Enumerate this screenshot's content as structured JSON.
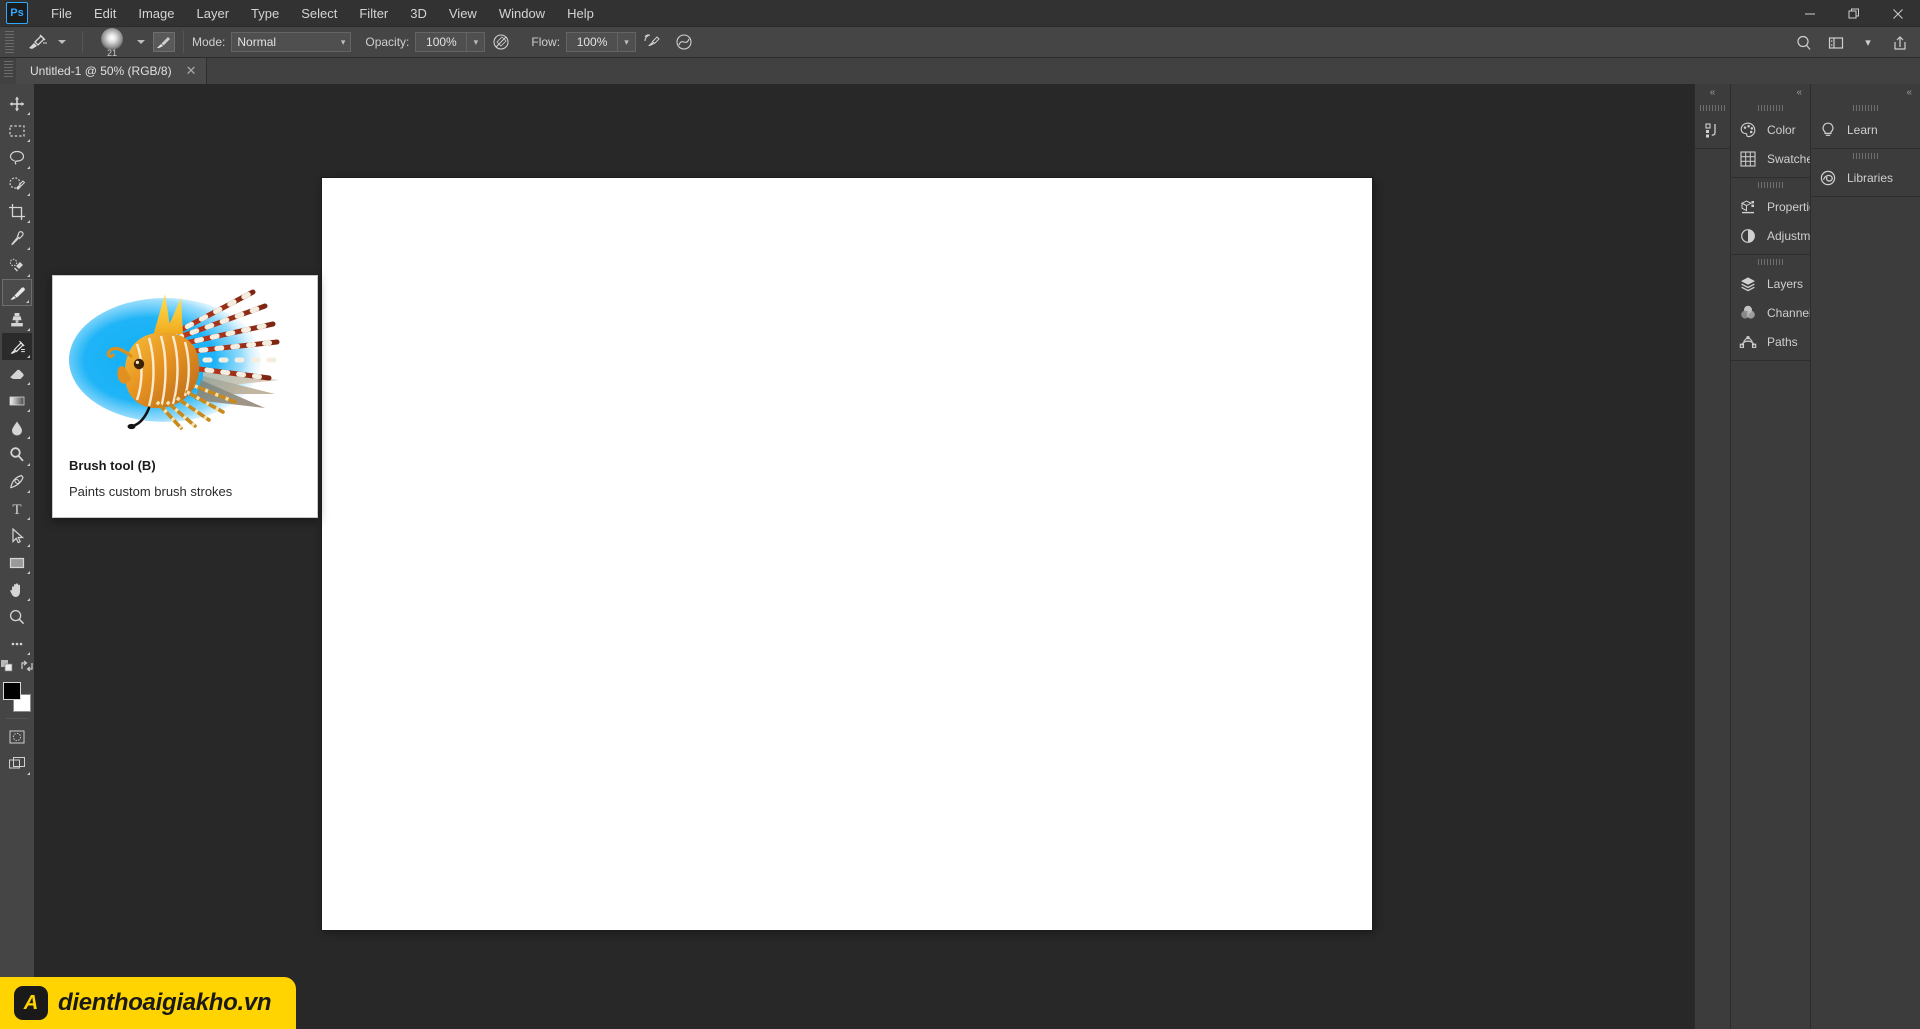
{
  "app": {
    "logo": "Ps",
    "menu": [
      "File",
      "Edit",
      "Image",
      "Layer",
      "Type",
      "Select",
      "Filter",
      "3D",
      "View",
      "Window",
      "Help"
    ],
    "window_controls": [
      {
        "name": "minimize",
        "glyph": "—"
      },
      {
        "name": "restore",
        "glyph": "❐"
      },
      {
        "name": "close",
        "glyph": "✕"
      }
    ]
  },
  "options_bar": {
    "tool_preset_label": "brush-tool-preset",
    "brush_size": "21",
    "mode_label": "Mode:",
    "mode_value": "Normal",
    "opacity_label": "Opacity:",
    "opacity_value": "100%",
    "flow_label": "Flow:",
    "flow_value": "100%",
    "airbrush_name": "airbrush-toggle",
    "smoothing_name": "smoothing-toggle",
    "pressure_opacity_name": "pressure-opacity-toggle",
    "pressure_size_name": "pressure-size-toggle",
    "symmetry_name": "symmetry-toggle",
    "right_icons": [
      {
        "name": "search-icon",
        "glyph": "⚲"
      },
      {
        "name": "workspace-icon",
        "glyph": "▣"
      },
      {
        "name": "workspace-chevron-icon",
        "glyph": "⌄"
      },
      {
        "name": "share-icon",
        "glyph": "⇧"
      }
    ]
  },
  "tabs": [
    {
      "title": "Untitled-1 @ 50% (RGB/8)",
      "close": "✕",
      "active": true
    }
  ],
  "toolbar": {
    "tools": [
      {
        "name": "move-tool",
        "label": "Move tool",
        "state": "normal",
        "flyout": true
      },
      {
        "name": "rectangular-marquee-tool",
        "label": "Rectangular Marquee tool",
        "state": "normal",
        "flyout": true
      },
      {
        "name": "lasso-tool",
        "label": "Lasso tool",
        "state": "normal",
        "flyout": true
      },
      {
        "name": "quick-selection-tool",
        "label": "Object Selection tool",
        "state": "normal",
        "flyout": true
      },
      {
        "name": "crop-tool",
        "label": "Crop tool",
        "state": "normal",
        "flyout": true
      },
      {
        "name": "eyedropper-tool",
        "label": "Eyedropper tool",
        "state": "normal",
        "flyout": true
      },
      {
        "name": "spot-healing-brush-tool",
        "label": "Spot Healing Brush tool",
        "state": "normal",
        "flyout": true
      },
      {
        "name": "brush-tool",
        "label": "Brush tool",
        "state": "hover",
        "flyout": true
      },
      {
        "name": "clone-stamp-tool",
        "label": "Clone Stamp tool",
        "state": "normal",
        "flyout": true
      },
      {
        "name": "history-brush-tool",
        "label": "History Brush tool",
        "state": "active",
        "flyout": true
      },
      {
        "name": "eraser-tool",
        "label": "Eraser tool",
        "state": "normal",
        "flyout": true
      },
      {
        "name": "gradient-tool",
        "label": "Gradient tool",
        "state": "normal",
        "flyout": true
      },
      {
        "name": "blur-tool",
        "label": "Blur tool",
        "state": "normal",
        "flyout": true
      },
      {
        "name": "dodge-tool",
        "label": "Dodge tool",
        "state": "normal",
        "flyout": true
      },
      {
        "name": "pen-tool",
        "label": "Pen tool",
        "state": "normal",
        "flyout": true
      },
      {
        "name": "horizontal-type-tool",
        "label": "Horizontal Type tool",
        "state": "normal",
        "flyout": true
      },
      {
        "name": "path-selection-tool",
        "label": "Path Selection tool",
        "state": "normal",
        "flyout": true
      },
      {
        "name": "rectangle-tool",
        "label": "Rectangle tool",
        "state": "normal",
        "flyout": true
      },
      {
        "name": "hand-tool",
        "label": "Hand tool",
        "state": "normal",
        "flyout": true
      },
      {
        "name": "zoom-tool",
        "label": "Zoom tool",
        "state": "normal",
        "flyout": true
      },
      {
        "name": "edit-toolbar-button",
        "label": "Edit Toolbar",
        "state": "normal",
        "flyout": true
      }
    ],
    "foreground_color": "#000000",
    "background_color": "#ffffff",
    "default_colors_name": "default-colors-icon",
    "swap_colors_name": "swap-colors-icon",
    "quick_mask_name": "quick-mask-button",
    "screen_mode_name": "screen-mode-button"
  },
  "tooltip": {
    "title": "Brush tool (B)",
    "description": "Paints custom brush strokes",
    "image_name": "lionfish-brush-illustration"
  },
  "document": {
    "zoom": "50%",
    "color_mode": "RGB/8",
    "canvas_background": "#ffffff"
  },
  "panels": {
    "collapse_glyph": "«",
    "column_narrow": [
      {
        "name": "history-panel-icon",
        "label": "History"
      }
    ],
    "groups": [
      {
        "items": [
          {
            "name": "color-panel",
            "label": "Color",
            "icon": "color-palette-icon"
          },
          {
            "name": "swatches-panel",
            "label": "Swatches",
            "icon": "swatches-grid-icon"
          }
        ]
      },
      {
        "items": [
          {
            "name": "properties-panel",
            "label": "Properties",
            "icon": "properties-icon"
          },
          {
            "name": "adjustments-panel",
            "label": "Adjustments",
            "icon": "adjustments-half-circle-icon"
          }
        ]
      },
      {
        "items": [
          {
            "name": "layers-panel",
            "label": "Layers",
            "icon": "layers-stack-icon"
          },
          {
            "name": "channels-panel",
            "label": "Channels",
            "icon": "channels-venn-icon"
          },
          {
            "name": "paths-panel",
            "label": "Paths",
            "icon": "paths-bezier-icon"
          }
        ]
      }
    ],
    "far_groups": [
      {
        "items": [
          {
            "name": "learn-panel",
            "label": "Learn",
            "icon": "lightbulb-icon"
          }
        ]
      },
      {
        "items": [
          {
            "name": "libraries-panel",
            "label": "Libraries",
            "icon": "creative-cloud-icon"
          }
        ]
      }
    ]
  },
  "watermark": {
    "badge": "A",
    "text": "dienthoaigiakho.vn",
    "background": "#ffd400"
  }
}
